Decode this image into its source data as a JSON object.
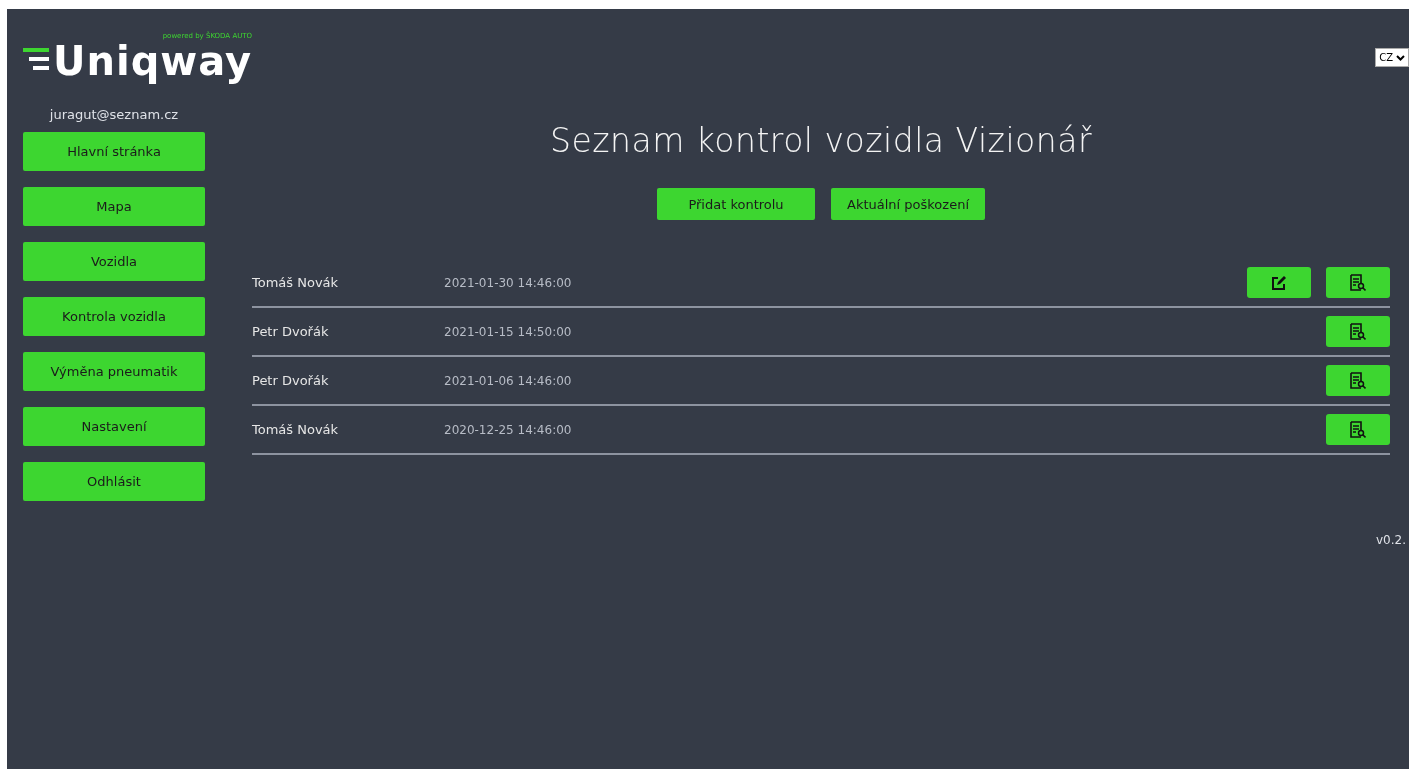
{
  "logo": {
    "name": "Uniqway",
    "tagline": "powered by ŠKODA AUTO"
  },
  "language": {
    "value": "CZ"
  },
  "user_email": "juragut@seznam.cz",
  "nav": [
    "Hlavní stránka",
    "Mapa",
    "Vozidla",
    "Kontrola vozidla",
    "Výměna pneumatik",
    "Nastavení",
    "Odhlásit"
  ],
  "title": "Seznam kontrol vozidla Vizionář",
  "actions": [
    "Přidat kontrolu",
    "Aktuální poškození"
  ],
  "rows": [
    {
      "name": "Tomáš Novák",
      "date": "2021-01-30 14:46:00",
      "editable": true
    },
    {
      "name": "Petr Dvořák",
      "date": "2021-01-15 14:50:00",
      "editable": false
    },
    {
      "name": "Petr Dvořák",
      "date": "2021-01-06 14:46:00",
      "editable": false
    },
    {
      "name": "Tomáš Novák",
      "date": "2020-12-25 14:46:00",
      "editable": false
    }
  ],
  "version": "v0.2."
}
